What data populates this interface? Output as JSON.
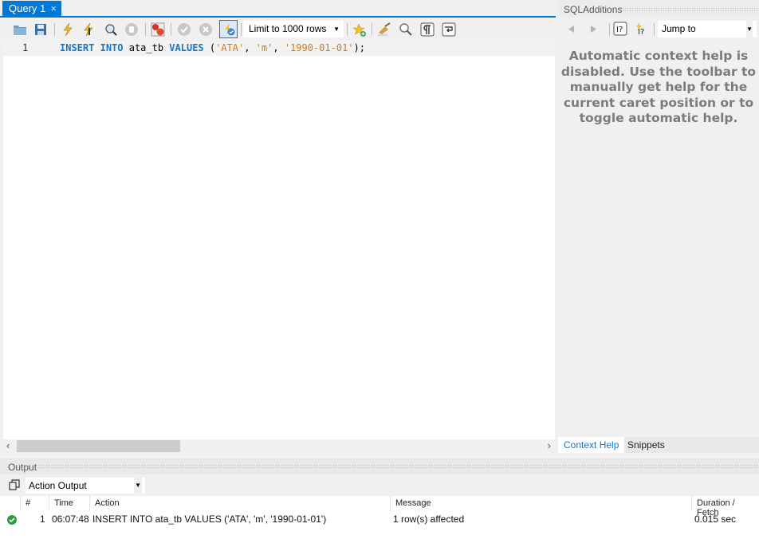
{
  "editor": {
    "tab_label": "Query 1",
    "tab_close": "×",
    "toolbar": {
      "icons": [
        "open-file-icon",
        "save-icon",
        "execute-icon",
        "execute-current-icon",
        "explain-icon",
        "stop-icon",
        "toggle-error-stop-icon",
        "commit-icon",
        "rollback-icon",
        "autocommit-icon",
        "add-snippet-icon",
        "beautify-icon",
        "find-icon",
        "invisible-chars-icon",
        "word-wrap-icon"
      ],
      "limit_select": "Limit to 1000 rows"
    },
    "lines": [
      {
        "number": "1",
        "tokens": [
          {
            "type": "kw",
            "text": "INSERT"
          },
          {
            "type": "plain",
            "text": " "
          },
          {
            "type": "kw",
            "text": "INTO"
          },
          {
            "type": "plain",
            "text": " ata_tb "
          },
          {
            "type": "kw",
            "text": "VALUES"
          },
          {
            "type": "plain",
            "text": " ("
          },
          {
            "type": "str",
            "text": "'ATA'"
          },
          {
            "type": "plain",
            "text": ", "
          },
          {
            "type": "str",
            "text": "'m'"
          },
          {
            "type": "plain",
            "text": ", "
          },
          {
            "type": "str",
            "text": "'1990-01-01'"
          },
          {
            "type": "plain",
            "text": ");"
          }
        ]
      }
    ],
    "scroll_left": "‹",
    "scroll_right": "›"
  },
  "side": {
    "title": "SQLAdditions",
    "jump_select": "Jump to",
    "help_text": "Automatic context help is disabled. Use the toolbar to manually get help for the current caret position or to toggle automatic help.",
    "tabs": [
      {
        "label": "Context Help",
        "active": true
      },
      {
        "label": "Snippets",
        "active": false
      }
    ]
  },
  "output": {
    "title": "Output",
    "select": "Action Output",
    "columns": [
      "#",
      "Time",
      "Action",
      "Message",
      "Duration / Fetch"
    ],
    "rows": [
      {
        "status": "success",
        "index": "1",
        "time": "06:07:48",
        "action": "INSERT INTO ata_tb VALUES ('ATA', 'm', '1990-01-01')",
        "message": "1 row(s) affected",
        "duration": "0.015 sec"
      }
    ]
  },
  "colors": {
    "accent": "#0078d7",
    "keyword": "#1a75c4",
    "string": "#d27a1f",
    "success": "#2c9e3a"
  }
}
